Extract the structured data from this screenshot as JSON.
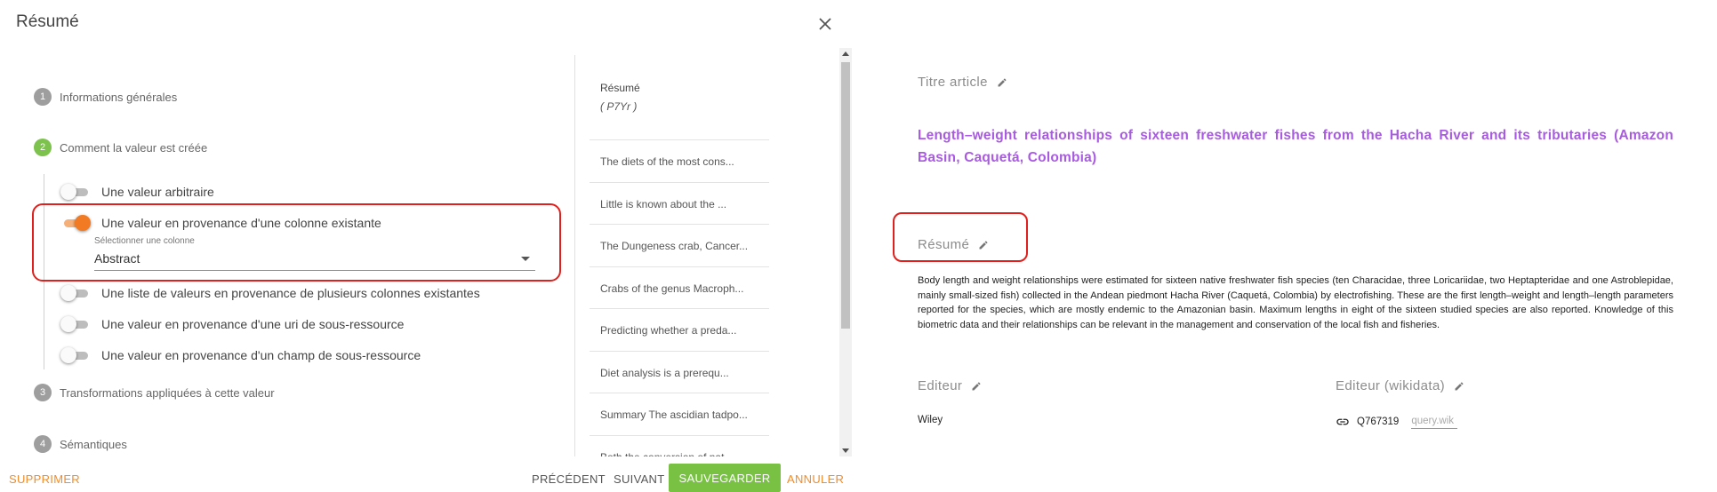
{
  "dialog": {
    "title": "Résumé",
    "steps": [
      {
        "num": "1",
        "label": "Informations générales"
      },
      {
        "num": "2",
        "label": "Comment la valeur est créée"
      },
      {
        "num": "3",
        "label": "Transformations appliquées à cette valeur"
      },
      {
        "num": "4",
        "label": "Sémantiques"
      }
    ],
    "options": [
      {
        "label": "Une valeur arbitraire",
        "on": false
      },
      {
        "label": "Une valeur en provenance d'une colonne existante",
        "on": true
      },
      {
        "label": "Une liste de valeurs en provenance de plusieurs colonnes existantes",
        "on": false
      },
      {
        "label": "Une valeur en provenance d'une uri de sous-ressource",
        "on": false
      },
      {
        "label": "Une valeur en provenance d'un champ de sous-ressource",
        "on": false
      }
    ],
    "column_select": {
      "caption": "Sélectionner une colonne",
      "value": "Abstract"
    },
    "preview": {
      "header": "Résumé",
      "sub": "( P7Yr )",
      "items": [
        "The diets of the most cons...",
        "Little is known about the ...",
        "The Dungeness crab, Cancer...",
        "Crabs of the genus Macroph...",
        "Predicting whether a preda...",
        "Diet analysis is a prerequ...",
        "Summary The ascidian tadpo...",
        "Both the conversion of nat..."
      ]
    },
    "footer": {
      "delete": "SUPPRIMER",
      "prev": "PRÉCÉDENT",
      "next": "SUIVANT",
      "save": "SAUVEGARDER",
      "cancel": "ANNULER"
    }
  },
  "record": {
    "title_label": "Titre article",
    "title": "Length–weight relationships of sixteen freshwater fishes from the Hacha River and its tributaries (Amazon Basin, Caquetá, Colombia)",
    "abstract_label": "Résumé",
    "abstract": "Body length and weight relationships were estimated for sixteen native freshwater fish species (ten Characidae, three Loricariidae, two Heptapteridae and one Astroblepidae, mainly small-sized fish) collected in the Andean piedmont Hacha River (Caquetá, Colombia) by electrofishing. These are the first length–weight and length–length parameters reported for the species, which are mostly endemic to the Amazonian basin. Maximum lengths in eight of the sixteen studied species are also reported. Knowledge of this biometric data and their relationships can be relevant in the management and conservation of the local fish and fisheries.",
    "editor_label": "Editeur",
    "editor": "Wiley",
    "editor_wd_label": "Editeur (wikidata)",
    "editor_wd_id": "Q767319",
    "editor_wd_query": "query.wik"
  },
  "colors": {
    "accent_orange": "#f27a22",
    "save_green": "#79c143",
    "title_purple": "#a85be0",
    "highlight_red": "#e0201c"
  }
}
